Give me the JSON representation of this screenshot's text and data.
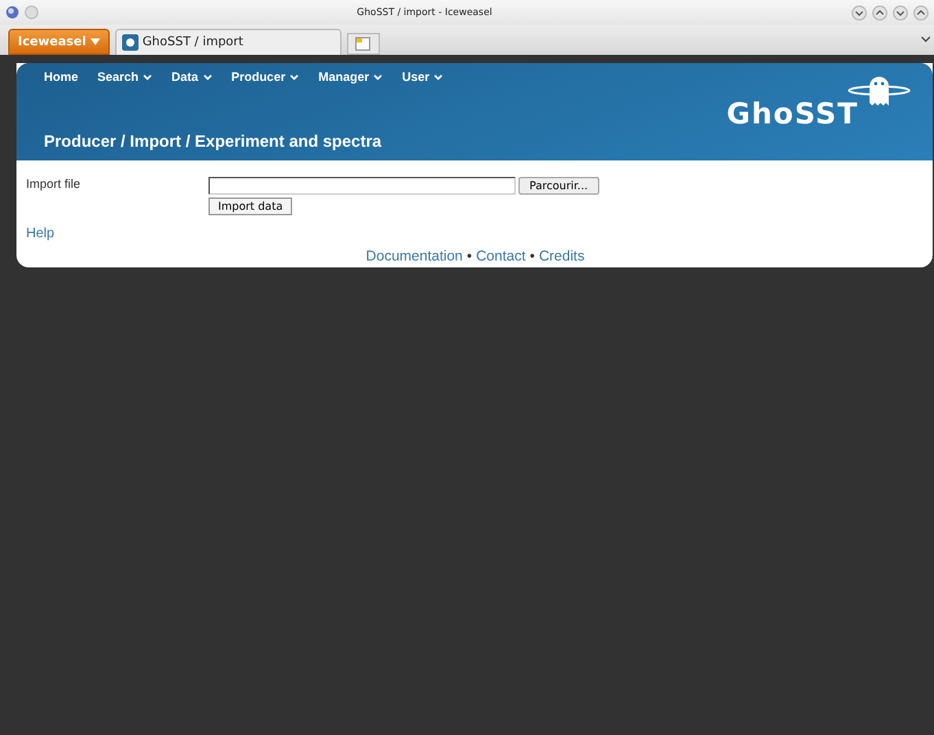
{
  "window": {
    "title": "GhoSST / import - Iceweasel"
  },
  "browser": {
    "menu_button": "Iceweasel",
    "tabs": [
      {
        "label": "GhoSST / import",
        "selected": true
      }
    ]
  },
  "nav": [
    {
      "label": "Home",
      "dropdown": false
    },
    {
      "label": "Search",
      "dropdown": true
    },
    {
      "label": "Data",
      "dropdown": true
    },
    {
      "label": "Producer",
      "dropdown": true
    },
    {
      "label": "Manager",
      "dropdown": true
    },
    {
      "label": "User",
      "dropdown": true
    }
  ],
  "logo": "GhoSST",
  "page_title": "Producer / Import / Experiment and spectra",
  "form": {
    "label": "Import file",
    "browse_button": "Parcourir...",
    "submit_button": "Import data"
  },
  "help_link": "Help",
  "footer": [
    {
      "kind": "link",
      "text": "Documentation"
    },
    {
      "kind": "separator",
      "text": "•"
    },
    {
      "kind": "link",
      "text": "Contact"
    },
    {
      "kind": "separator",
      "text": "•"
    },
    {
      "kind": "link",
      "text": "Credits"
    }
  ]
}
